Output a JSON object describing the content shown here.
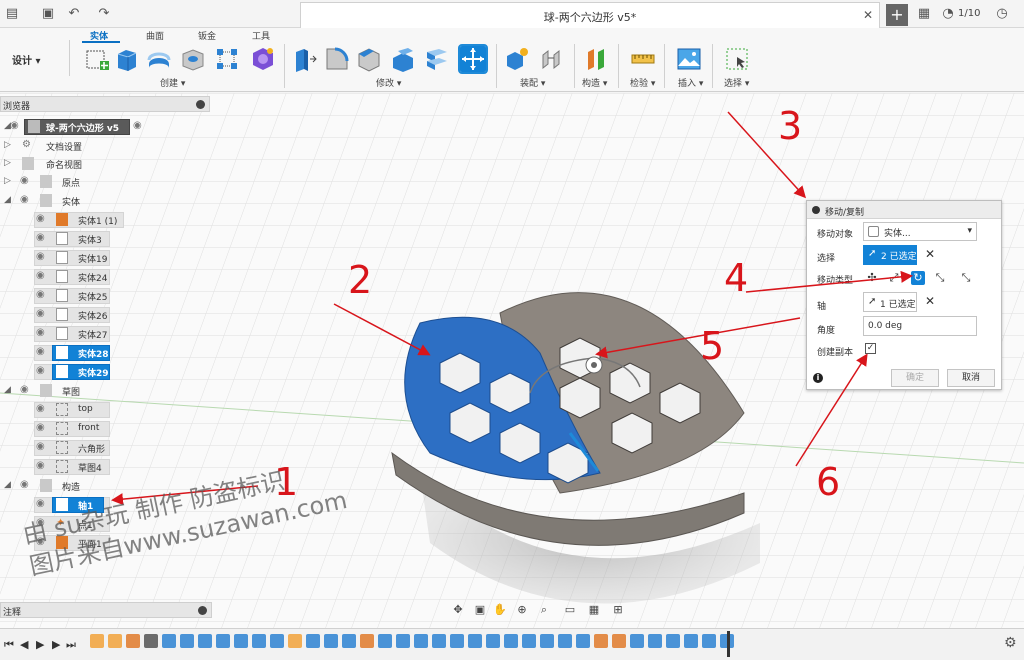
{
  "title": {
    "doc_tab": "球-两个六边形 v5*",
    "job_count": "1/10"
  },
  "ribbon": {
    "workspace": "设计 ▾",
    "tabs": [
      "实体",
      "曲面",
      "钣金",
      "工具"
    ],
    "groups": [
      "创建 ▾",
      "修改 ▾",
      "装配 ▾",
      "构造 ▾",
      "检验 ▾",
      "插入 ▾",
      "选择 ▾"
    ]
  },
  "browser": {
    "header": "浏览器",
    "root": "球-两个六边形 v5",
    "items": [
      {
        "label": "文档设置"
      },
      {
        "label": "命名视图"
      },
      {
        "label": "原点"
      },
      {
        "label": "实体"
      },
      {
        "label": "实体1 (1)"
      },
      {
        "label": "实体3"
      },
      {
        "label": "实体19"
      },
      {
        "label": "实体24"
      },
      {
        "label": "实体25"
      },
      {
        "label": "实体26"
      },
      {
        "label": "实体27"
      },
      {
        "label": "实体28"
      },
      {
        "label": "实体29"
      },
      {
        "label": "草图"
      },
      {
        "label": "top"
      },
      {
        "label": "front"
      },
      {
        "label": "六角形"
      },
      {
        "label": "草图4"
      },
      {
        "label": "构造"
      },
      {
        "label": "轴1"
      },
      {
        "label": "点1"
      },
      {
        "label": "平面1"
      }
    ],
    "comments": "注释"
  },
  "dialog": {
    "title": "移动/复制",
    "move_object_label": "移动对象",
    "move_object_value": "实体...",
    "selection_label": "选择",
    "selection_value": "2 已选定",
    "move_type_label": "移动类型",
    "axis_label": "轴",
    "axis_value": "1 已选定",
    "angle_label": "角度",
    "angle_value": "0.0 deg",
    "create_copy_label": "创建副本",
    "create_copy_checked": true,
    "ok_label": "确定",
    "cancel_label": "取消",
    "info_icon": "i"
  },
  "annotations": [
    "1",
    "2",
    "3",
    "4",
    "5",
    "6"
  ],
  "watermark": {
    "line1": "由 su杂玩 制作 防盗标识",
    "line2": "图片来自www.suzawan.com"
  },
  "colors": {
    "accent": "#1282d6",
    "annotation": "#d8151b",
    "body_blue": "#2d6fc4",
    "body_gray": "#8a8178"
  }
}
